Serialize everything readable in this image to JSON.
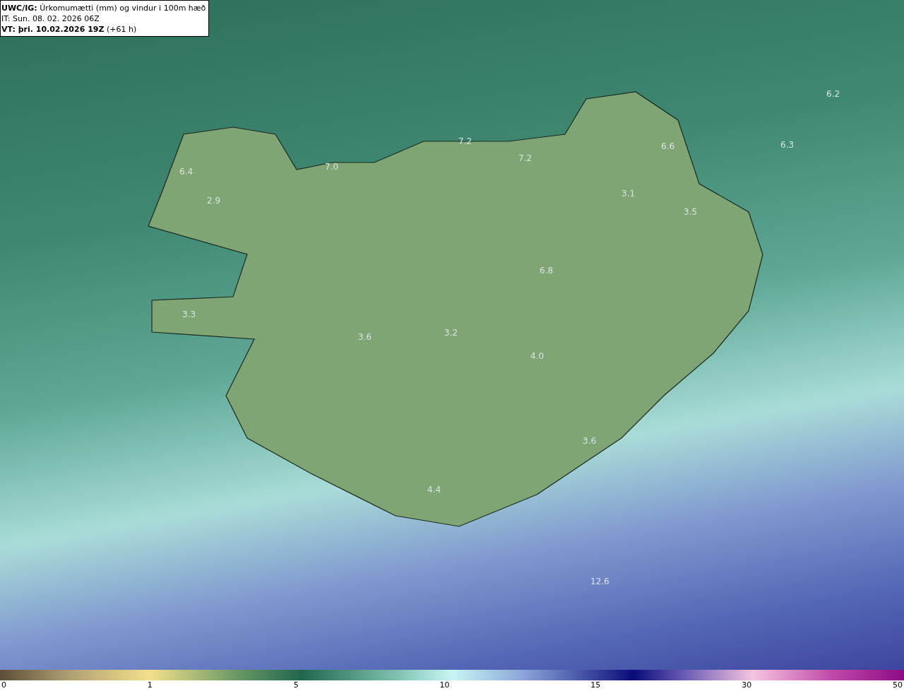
{
  "header": {
    "title": "**UWC/IG:** Úrkomumætti (mm) og vindur i 100m hæð",
    "initial_time": "IT: Sun. 08. 02. 2026 06Z",
    "valid_time": "**VT: þri. 10.02.2026 19Z** (+61 h)"
  },
  "map": {
    "labels": [
      "6.2",
      "6.6",
      "6.3",
      "7.2",
      "7.2",
      "6.4",
      "7.0",
      "2.9",
      "3.1",
      "3.5",
      "6.8",
      "3.3",
      "3.6",
      "3.2",
      "4.0",
      "3.6",
      "4.4",
      "12.6"
    ]
  },
  "legend": {
    "ticks": [
      "0",
      "1",
      "5",
      "10",
      "15",
      "30",
      "50"
    ]
  }
}
